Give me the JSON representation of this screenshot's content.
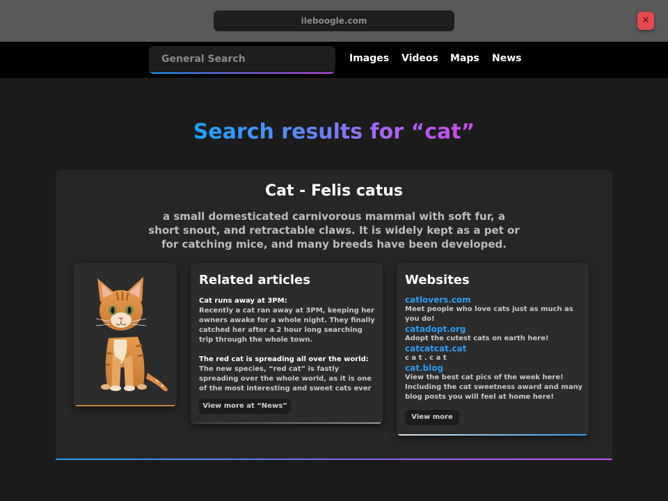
{
  "browser": {
    "url": "ileboogle.com",
    "close_label": "✕"
  },
  "nav": {
    "search_placeholder": "General Search",
    "links": [
      "Images",
      "Videos",
      "Maps",
      "News"
    ]
  },
  "results": {
    "heading": "Search results for “cat”"
  },
  "knowledge_panel": {
    "title": "Cat - Felis catus",
    "description": "a small domesticated carnivorous mammal with soft fur, a short snout, and retractable claws. It is widely kept as a pet or for catching mice, and many breeds have been developed."
  },
  "image_card": {
    "icon": "kitten-photo"
  },
  "articles": {
    "title": "Related articles",
    "items": [
      {
        "headline": "Cat runs away at 3PM:",
        "body": "Recently a cat ran away at 3PM, keeping her owners awake for a whole night. They finally catched her after a 2 hour long searching trip through the whole town."
      },
      {
        "headline": "The red cat is spreading all over the world:",
        "body": "The new species, “red cat” is fastly spreading over the whole world, as it is one of the most interesting and sweet cats ever"
      }
    ],
    "button": "View more at “News”"
  },
  "websites": {
    "title": "Websites",
    "items": [
      {
        "url": "catlovers.com",
        "desc": "Meet people who love cats just as much as you do!"
      },
      {
        "url": "catadopt.org",
        "desc": "Adopt the cutest cats on earth here!"
      },
      {
        "url": "catcatcat.cat",
        "desc": "c a t . c a t"
      },
      {
        "url": "cat.blog",
        "desc": "View the best cat pics of the week here! Including the cat sweetness award and many blog posts you will feel at home here!"
      }
    ],
    "button": "View more"
  },
  "colors": {
    "accent_blue": "#1ba0ff",
    "accent_purple": "#c94df0",
    "link_blue": "#2b9cf0",
    "close_red": "#e5484d"
  }
}
